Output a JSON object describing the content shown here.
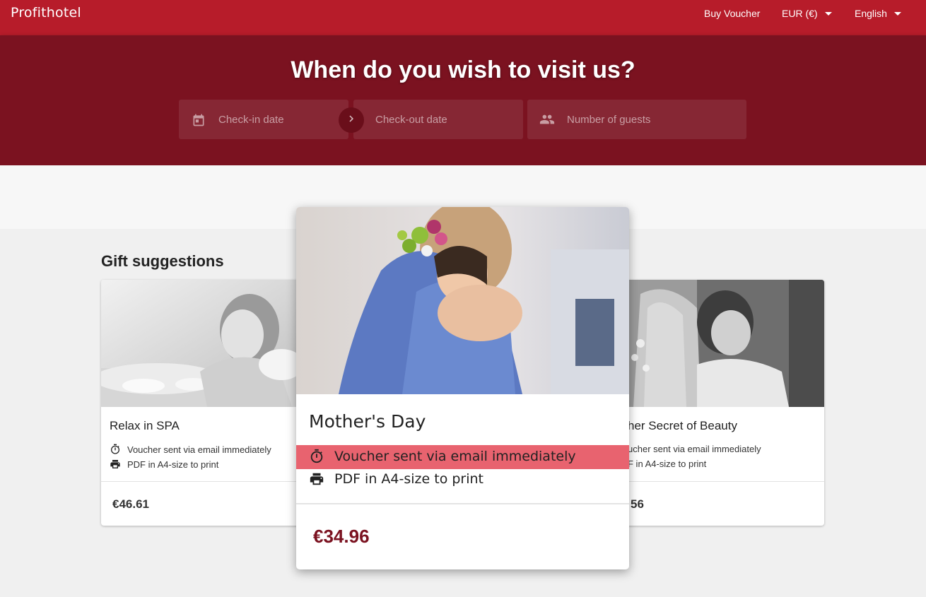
{
  "header": {
    "brand": "Profithotel",
    "buy_voucher": "Buy Voucher",
    "currency": "EUR (€)",
    "language": "English"
  },
  "hero": {
    "title": "When do you wish to visit us?",
    "checkin_placeholder": "Check-in date",
    "checkout_placeholder": "Check-out date",
    "guests_placeholder": "Number of guests"
  },
  "gifts": {
    "section_title": "Gift suggestions",
    "cards": [
      {
        "title": "Relax in SPA",
        "feature_1": "Voucher sent via email immediately",
        "feature_2": "PDF in A4-size to print",
        "price": "€46.61"
      },
      {
        "title": "Mother's Day",
        "feature_1": "Voucher sent via email immediately",
        "feature_2": "PDF in A4-size to print",
        "price": "€34.96"
      },
      {
        "title": "her Secret of Beauty",
        "feature_1": "ucher sent via email immediately",
        "feature_2": "F in A4-size to print",
        "price": "56"
      }
    ]
  },
  "colors": {
    "topbar": "#b71c2a",
    "hero": "#7b1220",
    "highlight": "#e8636f",
    "price_accent": "#7b1220"
  },
  "icons": [
    "calendar-icon",
    "chevron-right-icon",
    "people-icon",
    "timer-icon",
    "printer-icon",
    "caret-down-icon"
  ]
}
